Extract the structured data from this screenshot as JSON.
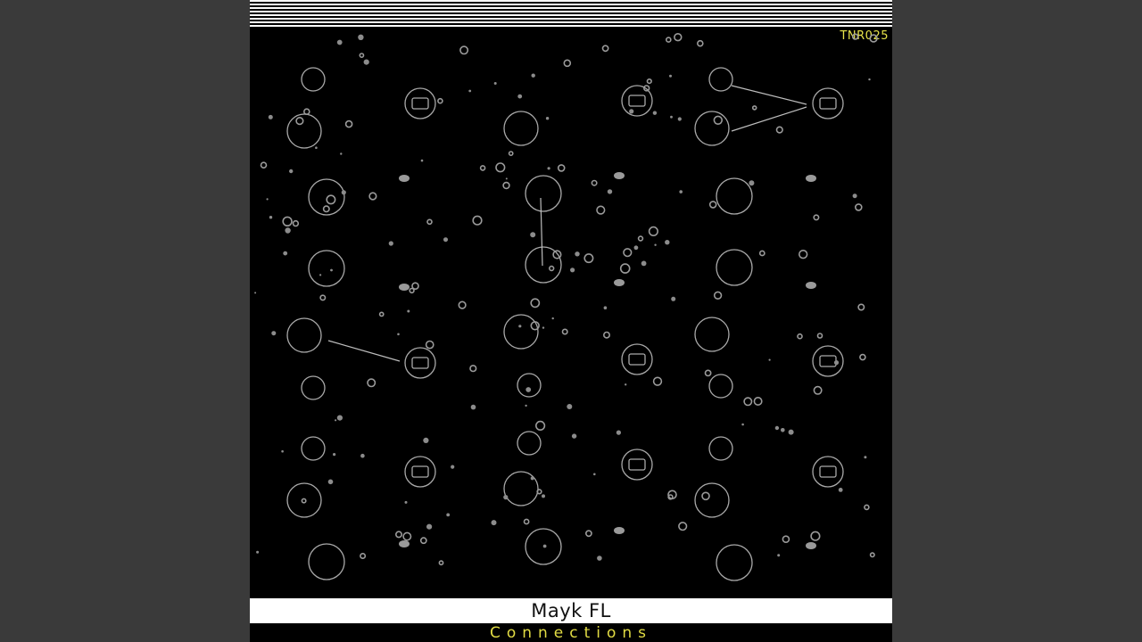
{
  "cover": {
    "catalog_number": "TNR025",
    "artist": "Mayk FL",
    "title": "Connections",
    "colors": {
      "background": "#000000",
      "stripes": "#ffffff",
      "accent": "#e7e34a",
      "artwork_lines": "#a9a9a9",
      "letterbox": "#3a3a3a"
    }
  }
}
